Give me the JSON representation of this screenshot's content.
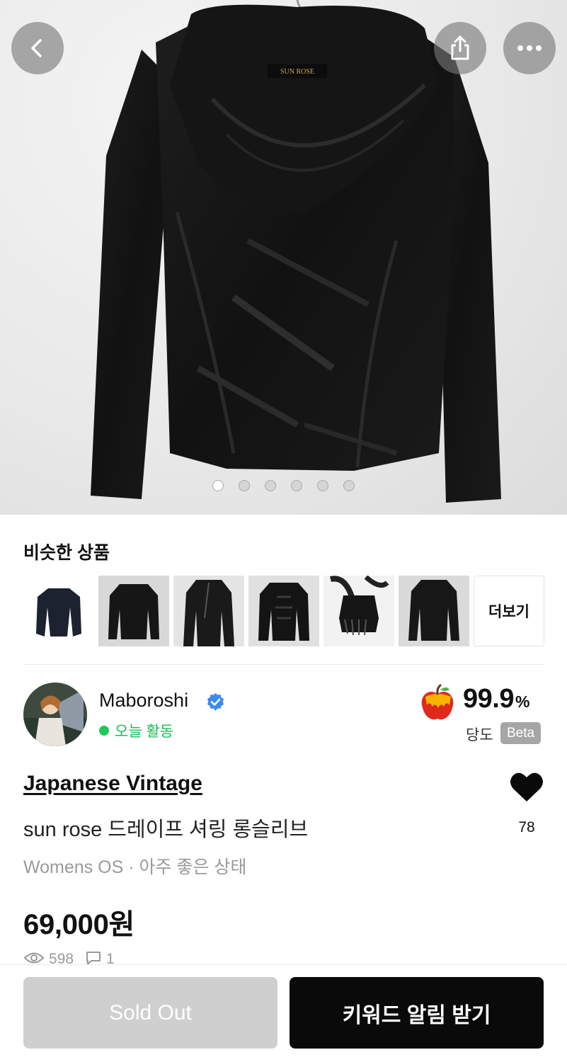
{
  "hero": {
    "garment_label": "SUN ROSE",
    "image_count": 6,
    "active_index": 0
  },
  "similar": {
    "title": "비슷한 상품",
    "more_label": "더보기",
    "thumbnails": [
      "jacket-1",
      "shirt-2",
      "leather-jacket-3",
      "frill-jacket-4",
      "lace-top-5",
      "shirt-6"
    ]
  },
  "seller": {
    "name": "Maboroshi",
    "activity": "오늘 활동",
    "score": "99.9",
    "score_unit": "%",
    "score_label": "당도",
    "badge": "Beta",
    "colors": {
      "active": "#1ec85a",
      "verified": "#3b8cf0"
    }
  },
  "product": {
    "shop": "Japanese Vintage",
    "title": "sun rose 드레이프 셔링 롱슬리브",
    "meta": "Womens OS · 아주 좋은 상태",
    "price": "69,000원",
    "likes": "78",
    "views": "598",
    "comments": "1"
  },
  "actions": {
    "sold_out": "Sold Out",
    "keyword_alert": "키워드 알림 받기"
  }
}
